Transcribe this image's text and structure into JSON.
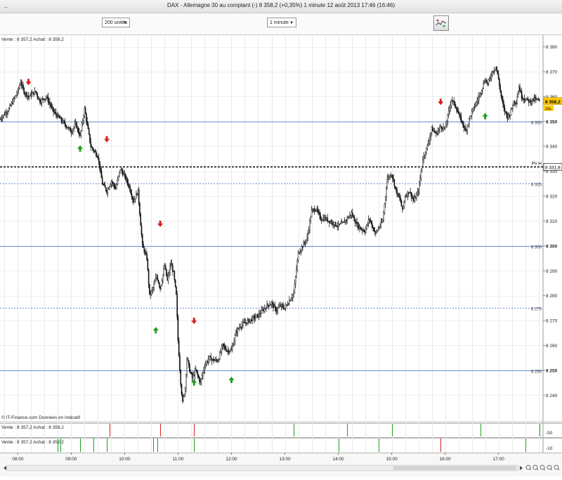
{
  "window": {
    "title": "DAX - Allemagne 30 au comptant (-)    8 358,2 (+0,35%)    1 minute  12 août 2013 17:46 (16:46)",
    "minimize": "_"
  },
  "toolbar": {
    "quantity": "200 unités",
    "timeframe": "1 minute"
  },
  "colors": {
    "up_arrow": "#1f9e1f",
    "down_arrow": "#d42020",
    "price_badge": "#ffcc00",
    "level_line": "#6a8fd0",
    "pivot_line": "#000000"
  },
  "main_panel": {
    "header": "Vente : 8 357,2 Achat : 8 359,2",
    "pivot_label": "Pv H",
    "pivot_value": "8 331,8",
    "price_badge": "8 358,2",
    "price_badge_sub": "24s",
    "footer": "© IT-Finance.com  Données en indicatif"
  },
  "ind_panel1": {
    "header": "Vente : 8 357,2 Achat : 8 359,2",
    "right_label": "-50"
  },
  "ind_panel2": {
    "header": "Vente : 8 357,2 Achat : 8 359,2",
    "right_label": "-10"
  },
  "chart_data": {
    "type": "candlestick",
    "title": "DAX - Allemagne 30 au comptant (-)",
    "yticks": [
      8240,
      8250,
      8260,
      8270,
      8280,
      8290,
      8300,
      8310,
      8320,
      8330,
      8340,
      8350,
      8360,
      8370,
      8380
    ],
    "ytick_labels": [
      "8 240",
      "8 250",
      "8 260",
      "8 270",
      "8 280",
      "8 290",
      "8 300",
      "8 310",
      "8 320",
      "8 330",
      "8 340",
      "8 350",
      "8 360",
      "8 370",
      "8 380"
    ],
    "ylim": [
      8235,
      8383
    ],
    "xlim": [
      "07:40",
      "17:50"
    ],
    "xticks": [
      "08:00",
      "09:00",
      "10:00",
      "11:00",
      "12:00",
      "13:00",
      "14:00",
      "15:00",
      "16:00",
      "17:00"
    ],
    "levels": [
      {
        "value": 8250,
        "style": "solid",
        "label": "8 250"
      },
      {
        "value": 8275,
        "style": "dotted",
        "label": "8 275"
      },
      {
        "value": 8300,
        "style": "solid",
        "label": "8 300"
      },
      {
        "value": 8325,
        "style": "dotted",
        "label": "8 325"
      },
      {
        "value": 8350,
        "style": "solid",
        "label": "8 350"
      }
    ],
    "pivot": 8331.8,
    "last_price": 8358.2,
    "price_path": [
      [
        "07:40",
        8351
      ],
      [
        "07:50",
        8355
      ],
      [
        "08:00",
        8362
      ],
      [
        "08:03",
        8366
      ],
      [
        "08:07",
        8362
      ],
      [
        "08:12",
        8360
      ],
      [
        "08:20",
        8362
      ],
      [
        "08:25",
        8358
      ],
      [
        "08:32",
        8360
      ],
      [
        "08:40",
        8354
      ],
      [
        "08:50",
        8350
      ],
      [
        "09:00",
        8346
      ],
      [
        "09:05",
        8349
      ],
      [
        "09:10",
        8344
      ],
      [
        "09:15",
        8355
      ],
      [
        "09:22",
        8340
      ],
      [
        "09:30",
        8336
      ],
      [
        "09:35",
        8325
      ],
      [
        "09:40",
        8322
      ],
      [
        "09:45",
        8326
      ],
      [
        "09:50",
        8323
      ],
      [
        "09:55",
        8331
      ],
      [
        "10:00",
        8328
      ],
      [
        "10:05",
        8324
      ],
      [
        "10:10",
        8318
      ],
      [
        "10:15",
        8322
      ],
      [
        "10:20",
        8300
      ],
      [
        "10:25",
        8295
      ],
      [
        "10:28",
        8280
      ],
      [
        "10:32",
        8283
      ],
      [
        "10:36",
        8288
      ],
      [
        "10:40",
        8283
      ],
      [
        "10:45",
        8292
      ],
      [
        "10:48",
        8286
      ],
      [
        "10:52",
        8293
      ],
      [
        "10:55",
        8289
      ],
      [
        "10:58",
        8280
      ],
      [
        "11:00",
        8262
      ],
      [
        "11:03",
        8245
      ],
      [
        "11:05",
        8237
      ],
      [
        "11:08",
        8243
      ],
      [
        "11:10",
        8255
      ],
      [
        "11:13",
        8250
      ],
      [
        "11:16",
        8247
      ],
      [
        "11:20",
        8250
      ],
      [
        "11:25",
        8245
      ],
      [
        "11:30",
        8252
      ],
      [
        "11:35",
        8255
      ],
      [
        "11:40",
        8254
      ],
      [
        "11:45",
        8254
      ],
      [
        "11:50",
        8260
      ],
      [
        "11:55",
        8258
      ],
      [
        "12:00",
        8258
      ],
      [
        "12:05",
        8265
      ],
      [
        "12:10",
        8268
      ],
      [
        "12:20",
        8270
      ],
      [
        "12:30",
        8272
      ],
      [
        "12:40",
        8276
      ],
      [
        "12:45",
        8277
      ],
      [
        "12:50",
        8274
      ],
      [
        "12:55",
        8276
      ],
      [
        "13:00",
        8275
      ],
      [
        "13:10",
        8281
      ],
      [
        "13:15",
        8297
      ],
      [
        "13:20",
        8300
      ],
      [
        "13:25",
        8303
      ],
      [
        "13:30",
        8314
      ],
      [
        "13:35",
        8315
      ],
      [
        "13:40",
        8311
      ],
      [
        "13:45",
        8311
      ],
      [
        "13:55",
        8309
      ],
      [
        "14:00",
        8308
      ],
      [
        "14:05",
        8309
      ],
      [
        "14:10",
        8311
      ],
      [
        "14:15",
        8313
      ],
      [
        "14:20",
        8309
      ],
      [
        "14:25",
        8307
      ],
      [
        "14:30",
        8306
      ],
      [
        "14:35",
        8311
      ],
      [
        "14:38",
        8308
      ],
      [
        "14:42",
        8305
      ],
      [
        "14:45",
        8307
      ],
      [
        "14:50",
        8310
      ],
      [
        "14:55",
        8327
      ],
      [
        "15:00",
        8329
      ],
      [
        "15:05",
        8322
      ],
      [
        "15:10",
        8318
      ],
      [
        "15:12",
        8314
      ],
      [
        "15:15",
        8320
      ],
      [
        "15:20",
        8322
      ],
      [
        "15:25",
        8318
      ],
      [
        "15:30",
        8322
      ],
      [
        "15:35",
        8335
      ],
      [
        "15:40",
        8340
      ],
      [
        "15:45",
        8347
      ],
      [
        "15:50",
        8345
      ],
      [
        "15:55",
        8348
      ],
      [
        "16:00",
        8347
      ],
      [
        "16:03",
        8352
      ],
      [
        "16:07",
        8359
      ],
      [
        "16:12",
        8356
      ],
      [
        "16:16",
        8352
      ],
      [
        "16:20",
        8349
      ],
      [
        "16:23",
        8346
      ],
      [
        "16:28",
        8352
      ],
      [
        "16:33",
        8356
      ],
      [
        "16:37",
        8359
      ],
      [
        "16:42",
        8364
      ],
      [
        "16:45",
        8367
      ],
      [
        "16:48",
        8365
      ],
      [
        "16:53",
        8370
      ],
      [
        "16:57",
        8372
      ],
      [
        "17:00",
        8367
      ],
      [
        "17:03",
        8360
      ],
      [
        "17:06",
        8355
      ],
      [
        "17:10",
        8352
      ],
      [
        "17:13",
        8353
      ],
      [
        "17:17",
        8358
      ],
      [
        "17:20",
        8358
      ],
      [
        "17:23",
        8364
      ],
      [
        "17:26",
        8360
      ],
      [
        "17:30",
        8359
      ],
      [
        "17:35",
        8358
      ],
      [
        "17:40",
        8359
      ],
      [
        "17:46",
        8358.2
      ]
    ],
    "signals": [
      {
        "time": "08:12",
        "price": 8366,
        "type": "sell"
      },
      {
        "time": "09:10",
        "price": 8339,
        "type": "buy"
      },
      {
        "time": "09:40",
        "price": 8343,
        "type": "sell"
      },
      {
        "time": "10:40",
        "price": 8309,
        "type": "sell"
      },
      {
        "time": "10:35",
        "price": 8266,
        "type": "buy"
      },
      {
        "time": "11:18",
        "price": 8270,
        "type": "sell"
      },
      {
        "time": "11:18",
        "price": 8245,
        "type": "buy"
      },
      {
        "time": "12:00",
        "price": 8246,
        "type": "buy"
      },
      {
        "time": "15:55",
        "price": 8358,
        "type": "sell"
      },
      {
        "time": "16:45",
        "price": 8352,
        "type": "buy"
      }
    ],
    "panel1_marks": [
      {
        "time": "09:43",
        "color": "red"
      },
      {
        "time": "10:40",
        "color": "red"
      },
      {
        "time": "11:18",
        "color": "red"
      },
      {
        "time": "13:10",
        "color": "green"
      },
      {
        "time": "14:10",
        "color": "green"
      },
      {
        "time": "15:00",
        "color": "green"
      },
      {
        "time": "16:40",
        "color": "green"
      },
      {
        "time": "17:46",
        "color": "green"
      }
    ],
    "panel2_marks": [
      {
        "time": "08:45",
        "color": "green"
      },
      {
        "time": "08:48",
        "color": "green"
      },
      {
        "time": "09:10",
        "color": "green"
      },
      {
        "time": "09:25",
        "color": "green"
      },
      {
        "time": "09:40",
        "color": "green"
      },
      {
        "time": "10:32",
        "color": "green"
      },
      {
        "time": "10:37",
        "color": "green"
      },
      {
        "time": "11:18",
        "color": "green"
      },
      {
        "time": "14:00",
        "color": "green"
      },
      {
        "time": "14:45",
        "color": "green"
      },
      {
        "time": "15:55",
        "color": "red"
      },
      {
        "time": "17:30",
        "color": "green"
      }
    ]
  }
}
